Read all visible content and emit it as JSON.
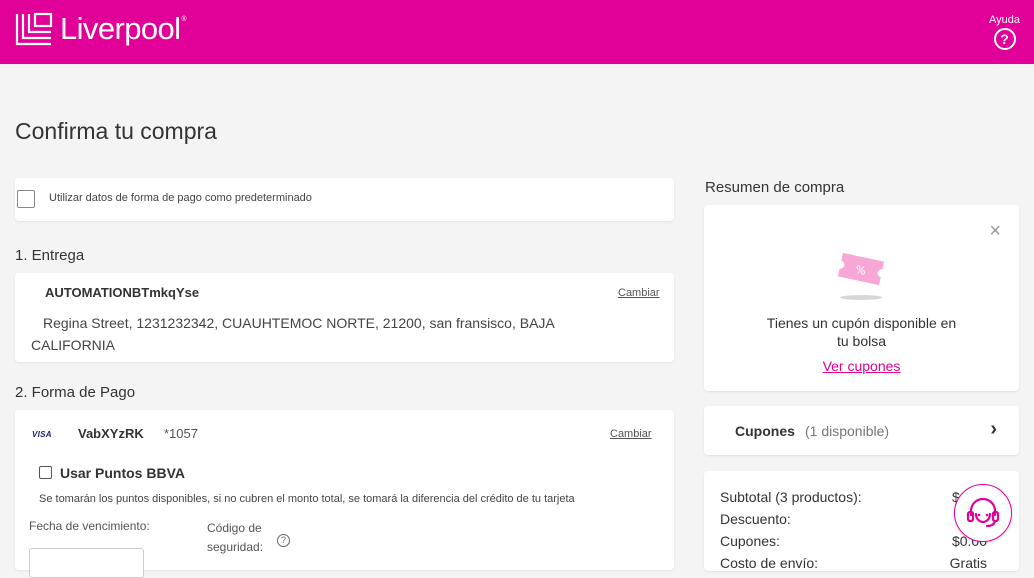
{
  "header": {
    "brand": "Liverpool",
    "brand_mark": "®",
    "help_label": "Ayuda",
    "help_icon": "?",
    "colors": {
      "brand": "#e10098",
      "background": "#f4f4f4"
    }
  },
  "page": {
    "title": "Confirma tu compra"
  },
  "default_payment": {
    "label": "Utilizar datos de forma de pago como predeterminado",
    "checked": false
  },
  "delivery": {
    "section_title": "1. Entrega",
    "recipient": "AUTOMATIONBTmkqYse",
    "change_label": "Cambiar",
    "address": "Regina Street, 1231232342, CUAUHTEMOC NORTE, 21200, san fransisco, BAJA CALIFORNIA"
  },
  "payment": {
    "section_title": "2. Forma de Pago",
    "card_brand": "VISA",
    "card_holder": "VabXYzRK",
    "card_number": "*1057",
    "change_label": "Cambiar",
    "bbva_points_label": "Usar Puntos BBVA",
    "bbva_points_checked": false,
    "bbva_note": "Se tomarán los puntos disponibles, si no cubren el monto total, se tomará la diferencia del crédito de tu tarjeta",
    "expiration_label": "Fecha de vencimiento:",
    "security_code_label": "Código de seguridad:",
    "security_info_icon": "?"
  },
  "summary": {
    "title": "Resumen de compra",
    "coupon_card": {
      "close_icon": "×",
      "text": "Tienes un cupón disponible en tu bolsa",
      "link": "Ver cupones"
    },
    "coupons_row": {
      "label": "Cupones",
      "count": "(1 disponible)",
      "chevron": "›"
    },
    "totals": [
      {
        "label": "Subtotal (3 productos):",
        "value": "$1,36"
      },
      {
        "label": "Descuento:",
        "value": "$"
      },
      {
        "label": "Cupones:",
        "value": "$0.00"
      },
      {
        "label": "Costo de envío:",
        "value": "Gratis"
      }
    ]
  }
}
